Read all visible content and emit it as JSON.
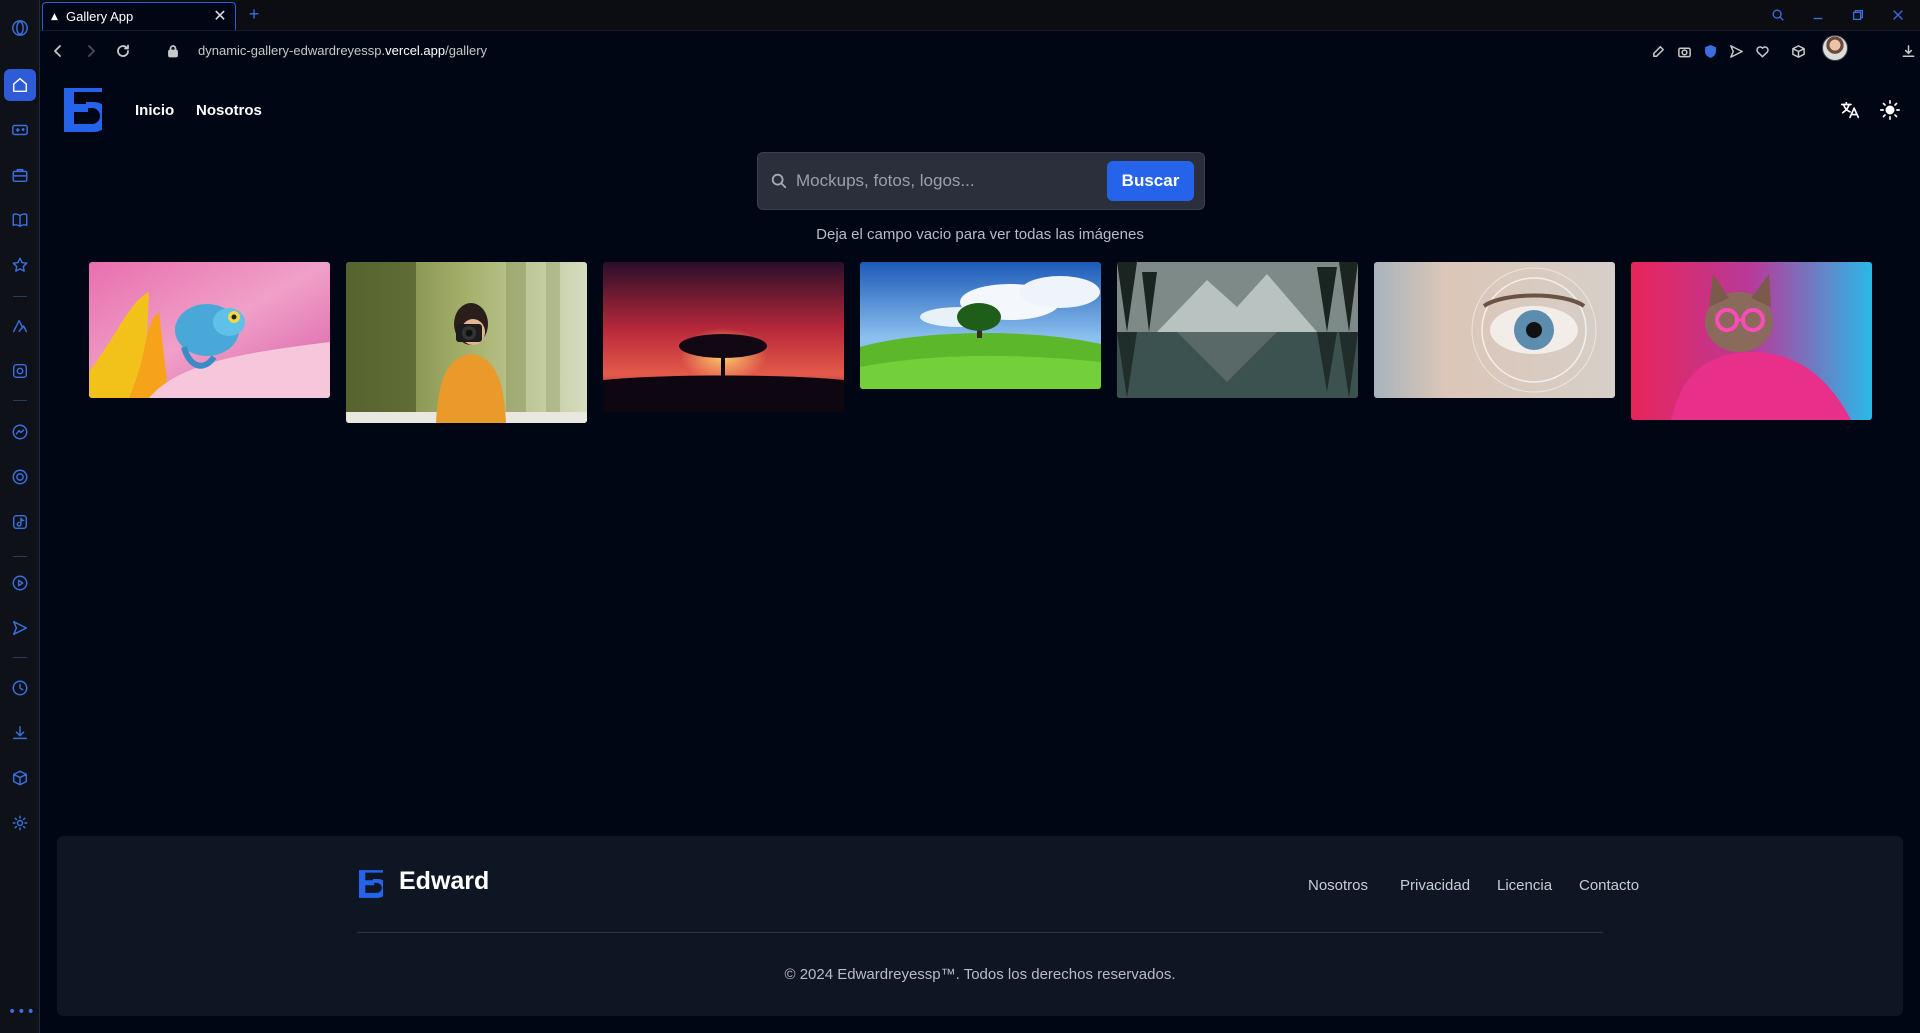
{
  "browser": {
    "tab_title": "Gallery App",
    "new_tab": "+",
    "url_prefix": "dynamic-gallery-edwardreyessp.",
    "url_domain": "vercel.app",
    "url_path": "/gallery"
  },
  "header": {
    "nav": [
      "Inicio",
      "Nosotros"
    ]
  },
  "search": {
    "placeholder": "Mockups, fotos, logos...",
    "value": "",
    "button": "Buscar",
    "hint": "Deja el campo vacio para ver todas las imágenes"
  },
  "gallery": {
    "images": [
      {
        "subject": "chameleon on pink flower"
      },
      {
        "subject": "woman with camera"
      },
      {
        "subject": "tree under red sky"
      },
      {
        "subject": "tree on green hill"
      },
      {
        "subject": "mountain lake reflection"
      },
      {
        "subject": "eye close-up"
      },
      {
        "subject": "cat with pink glasses"
      }
    ]
  },
  "footer": {
    "brand": "Edward",
    "links": [
      "Nosotros",
      "Privacidad",
      "Licencia",
      "Contacto"
    ],
    "copyright": "© 2024 Edwardreyessp™. Todos los derechos reservados."
  },
  "colors": {
    "background": "#000614",
    "accent": "#2563eb",
    "footer_bg": "#0e1523"
  }
}
